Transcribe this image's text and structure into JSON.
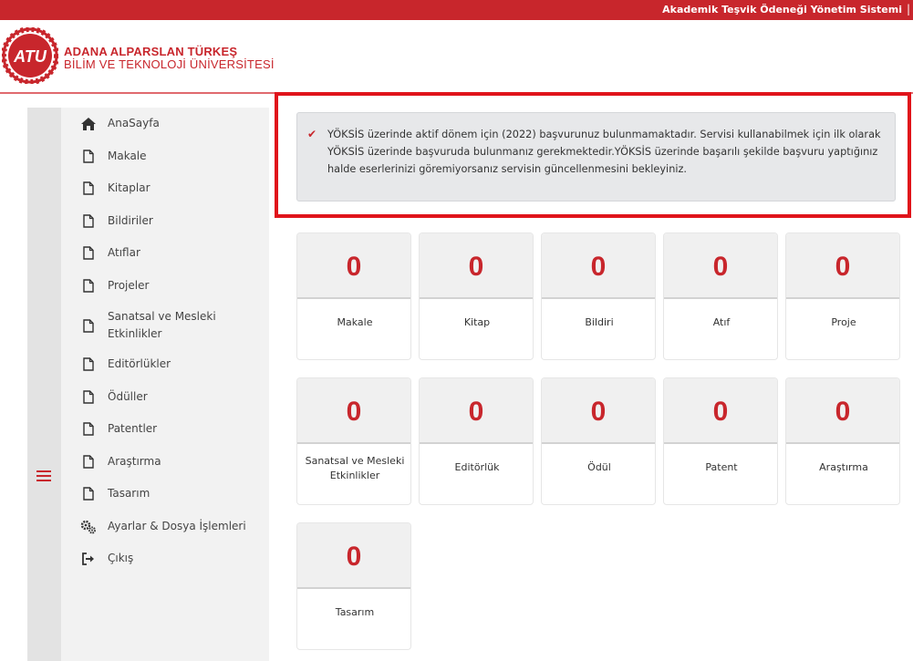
{
  "topbar": {
    "title": "Akademik Teşvik Ödeneği Yönetim Sistemi",
    "separator": "|"
  },
  "header": {
    "logo_text": "ATU",
    "university_line1": "ADANA ALPARSLAN TÜRKEŞ",
    "university_line2": "BİLİM VE TEKNOLOJİ ÜNİVERSİTESİ"
  },
  "sidebar": {
    "items": [
      {
        "label": "AnaSayfa",
        "icon": "home-icon"
      },
      {
        "label": "Makale",
        "icon": "file-icon"
      },
      {
        "label": "Kitaplar",
        "icon": "file-icon"
      },
      {
        "label": "Bildiriler",
        "icon": "file-icon"
      },
      {
        "label": "Atıflar",
        "icon": "file-icon"
      },
      {
        "label": "Projeler",
        "icon": "file-icon"
      },
      {
        "label": "Sanatsal ve Mesleki",
        "label2": "Etkinlikler",
        "icon": "file-icon"
      },
      {
        "label": "Editörlükler",
        "icon": "file-icon"
      },
      {
        "label": "Ödüller",
        "icon": "file-icon"
      },
      {
        "label": "Patentler",
        "icon": "file-icon"
      },
      {
        "label": "Araştırma",
        "icon": "file-icon"
      },
      {
        "label": "Tasarım",
        "icon": "file-icon"
      },
      {
        "label": "Ayarlar & Dosya İşlemleri",
        "icon": "gears-icon"
      },
      {
        "label": "Çıkış",
        "icon": "sign-out-icon"
      }
    ]
  },
  "notice": {
    "icon": "check-icon",
    "text": "YÖKSİS üzerinde aktif dönem için (2022) başvurunuz bulunmamaktadır. Servisi kullanabilmek için ilk olarak YÖKSİS üzerinde başvuruda bulunmanız gerekmektedir.YÖKSİS üzerinde başarılı şekilde başvuru yaptığınız halde eserlerinizi göremiyorsanız servisin güncellenmesini bekleyiniz."
  },
  "cards": [
    {
      "count": "0",
      "label": "Makale"
    },
    {
      "count": "0",
      "label": "Kitap"
    },
    {
      "count": "0",
      "label": "Bildiri"
    },
    {
      "count": "0",
      "label": "Atıf"
    },
    {
      "count": "0",
      "label": "Proje"
    },
    {
      "count": "0",
      "label": "Sanatsal ve Mesleki",
      "label2": "Etkinlikler"
    },
    {
      "count": "0",
      "label": "Editörlük"
    },
    {
      "count": "0",
      "label": "Ödül"
    },
    {
      "count": "0",
      "label": "Patent"
    },
    {
      "count": "0",
      "label": "Araştırma"
    },
    {
      "count": "0",
      "label": "Tasarım"
    }
  ],
  "colors": {
    "brand_red": "#c8262c",
    "highlight_red": "#e0141b"
  }
}
